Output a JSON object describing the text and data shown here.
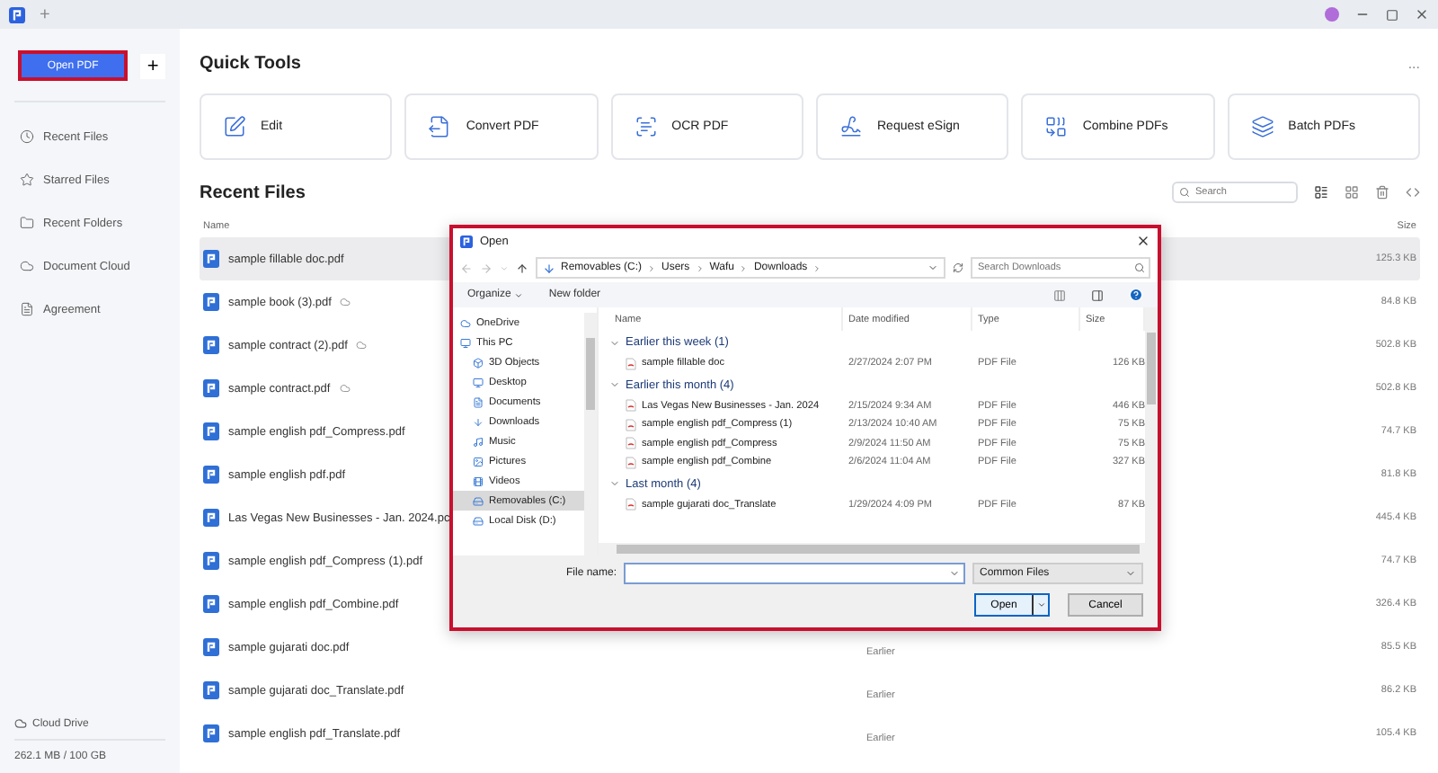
{
  "top_bar": {
    "new_tab": "+"
  },
  "sidebar": {
    "open_button": "Open PDF",
    "add_button": "+",
    "items": [
      {
        "label": "Recent Files"
      },
      {
        "label": "Starred Files"
      },
      {
        "label": "Recent Folders"
      },
      {
        "label": "Document Cloud"
      },
      {
        "label": "Agreement"
      }
    ],
    "cloud_drive": "Cloud Drive",
    "usage": "262.1 MB / 100 GB"
  },
  "quick_tools": {
    "title": "Quick Tools",
    "more": "...",
    "tools": [
      "Edit",
      "Convert PDF",
      "OCR PDF",
      "Request eSign",
      "Combine PDFs",
      "Batch PDFs"
    ]
  },
  "recent_files": {
    "title": "Recent Files",
    "search_placeholder": "Search",
    "columns": [
      "Name",
      "Size"
    ],
    "rows": [
      {
        "name": "sample fillable doc.pdf",
        "cloud": false,
        "size": "125.3 KB",
        "selected": true
      },
      {
        "name": "sample book (3).pdf",
        "cloud": true,
        "size": "84.8 KB",
        "selected": false
      },
      {
        "name": "sample contract (2).pdf",
        "cloud": true,
        "size": "502.8 KB",
        "selected": false
      },
      {
        "name": "sample contract.pdf",
        "cloud": true,
        "size": "502.8 KB",
        "selected": false
      },
      {
        "name": "sample english pdf_Compress.pdf",
        "cloud": false,
        "size": "74.7 KB",
        "selected": false
      },
      {
        "name": "sample english pdf.pdf",
        "cloud": false,
        "size": "81.8 KB",
        "selected": false
      },
      {
        "name": "Las Vegas New Businesses - Jan. 2024.pc",
        "cloud": false,
        "size": "445.4 KB",
        "selected": false
      },
      {
        "name": "sample english pdf_Compress (1).pdf",
        "cloud": false,
        "size": "74.7 KB",
        "selected": false
      },
      {
        "name": "sample english pdf_Combine.pdf",
        "cloud": false,
        "size": "326.4 KB",
        "selected": false
      },
      {
        "name": "sample gujarati doc.pdf",
        "cloud": false,
        "date": "Earlier",
        "size": "85.5 KB",
        "selected": false
      },
      {
        "name": "sample gujarati doc_Translate.pdf",
        "cloud": false,
        "date": "Earlier",
        "size": "86.2 KB",
        "selected": false
      },
      {
        "name": "sample english pdf_Translate.pdf",
        "cloud": false,
        "date": "Earlier",
        "size": "105.4 KB",
        "selected": false
      }
    ]
  },
  "dialog": {
    "title": "Open",
    "path": [
      "Removables (C:)",
      "Users",
      "Wafu",
      "Downloads"
    ],
    "search_placeholder": "Search Downloads",
    "organize": "Organize",
    "new_folder": "New folder",
    "nav": [
      {
        "label": "OneDrive",
        "selected": false
      },
      {
        "label": "This PC",
        "selected": false,
        "children": [
          {
            "label": "3D Objects",
            "selected": false
          },
          {
            "label": "Desktop",
            "selected": false
          },
          {
            "label": "Documents",
            "selected": false
          },
          {
            "label": "Downloads",
            "selected": false
          },
          {
            "label": "Music",
            "selected": false
          },
          {
            "label": "Pictures",
            "selected": false
          },
          {
            "label": "Videos",
            "selected": false
          },
          {
            "label": "Removables (C:)",
            "selected": true
          },
          {
            "label": "Local Disk (D:)",
            "selected": false
          }
        ]
      }
    ],
    "columns": [
      "Name",
      "Date modified",
      "Type",
      "Size"
    ],
    "groups": [
      {
        "title": "Earlier this week (1)",
        "expanded": true,
        "files": [
          {
            "name": "sample fillable doc",
            "date": "2/27/2024 2:07 PM",
            "type": "PDF File",
            "size": "126 KB"
          }
        ]
      },
      {
        "title": "Earlier this month (4)",
        "expanded": true,
        "files": [
          {
            "name": "Las Vegas New Businesses - Jan. 2024",
            "date": "2/15/2024 9:34 AM",
            "type": "PDF File",
            "size": "446 KB"
          },
          {
            "name": "sample english pdf_Compress (1)",
            "date": "2/13/2024 10:40 AM",
            "type": "PDF File",
            "size": "75 KB"
          },
          {
            "name": "sample english pdf_Compress",
            "date": "2/9/2024 11:50 AM",
            "type": "PDF File",
            "size": "75 KB"
          },
          {
            "name": "sample english pdf_Combine",
            "date": "2/6/2024 11:04 AM",
            "type": "PDF File",
            "size": "327 KB"
          }
        ]
      },
      {
        "title": "Last month (4)",
        "expanded": true,
        "files": [
          {
            "name": "sample gujarati doc_Translate",
            "date": "1/29/2024 4:09 PM",
            "type": "PDF File",
            "size": "87 KB"
          }
        ]
      }
    ],
    "file_name_label": "File name:",
    "file_type": "Common Files",
    "open_button": "Open",
    "cancel_button": "Cancel"
  }
}
